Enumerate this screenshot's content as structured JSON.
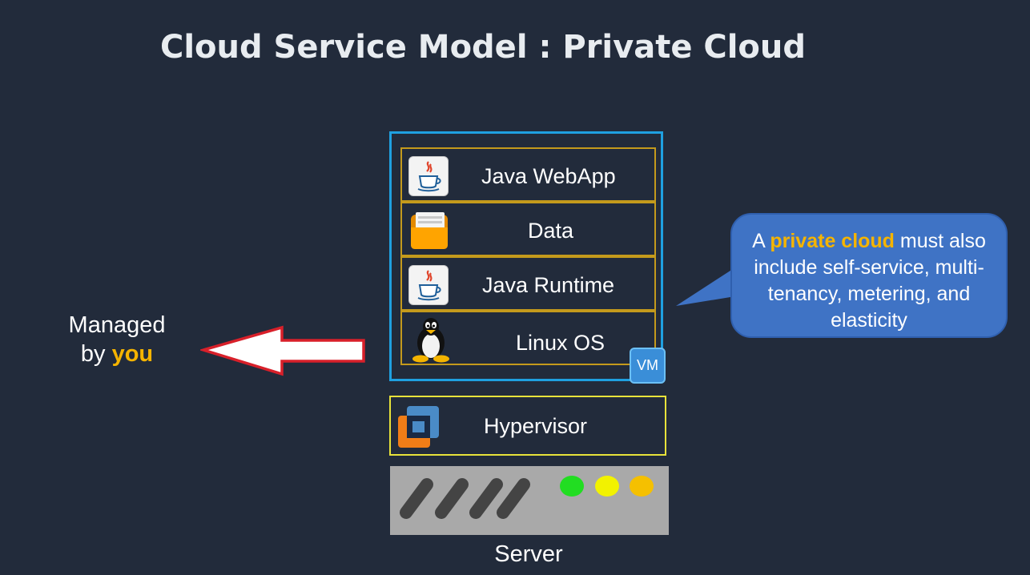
{
  "title": "Cloud Service Model : Private Cloud",
  "layers": [
    {
      "label": "Java WebApp",
      "icon": "java-icon"
    },
    {
      "label": "Data",
      "icon": "folder-icon"
    },
    {
      "label": "Java Runtime",
      "icon": "java-icon"
    },
    {
      "label": "Linux OS",
      "icon": "tux-penguin-icon"
    }
  ],
  "vm_badge": "VM",
  "hypervisor": {
    "label": "Hypervisor",
    "icon": "vmware-logo-icon"
  },
  "server": {
    "label": "Server",
    "status_lights": [
      "#22dd22",
      "#f2f200",
      "#f5c000"
    ]
  },
  "managed": {
    "line1": "Managed",
    "line2_prefix": "by ",
    "line2_highlight": "you"
  },
  "callout": {
    "prefix": "A ",
    "highlight": "private cloud",
    "suffix": " must also include self-service, multi-tenancy, metering, and elasticity"
  },
  "colors": {
    "background": "#222b3b",
    "vm_border": "#1fa0e0",
    "layer_border": "#c49a1c",
    "hypervisor_border": "#e8e23a",
    "highlight": "#f5b400",
    "callout_fill": "#3f73c5",
    "arrow_border": "#d8202a"
  }
}
